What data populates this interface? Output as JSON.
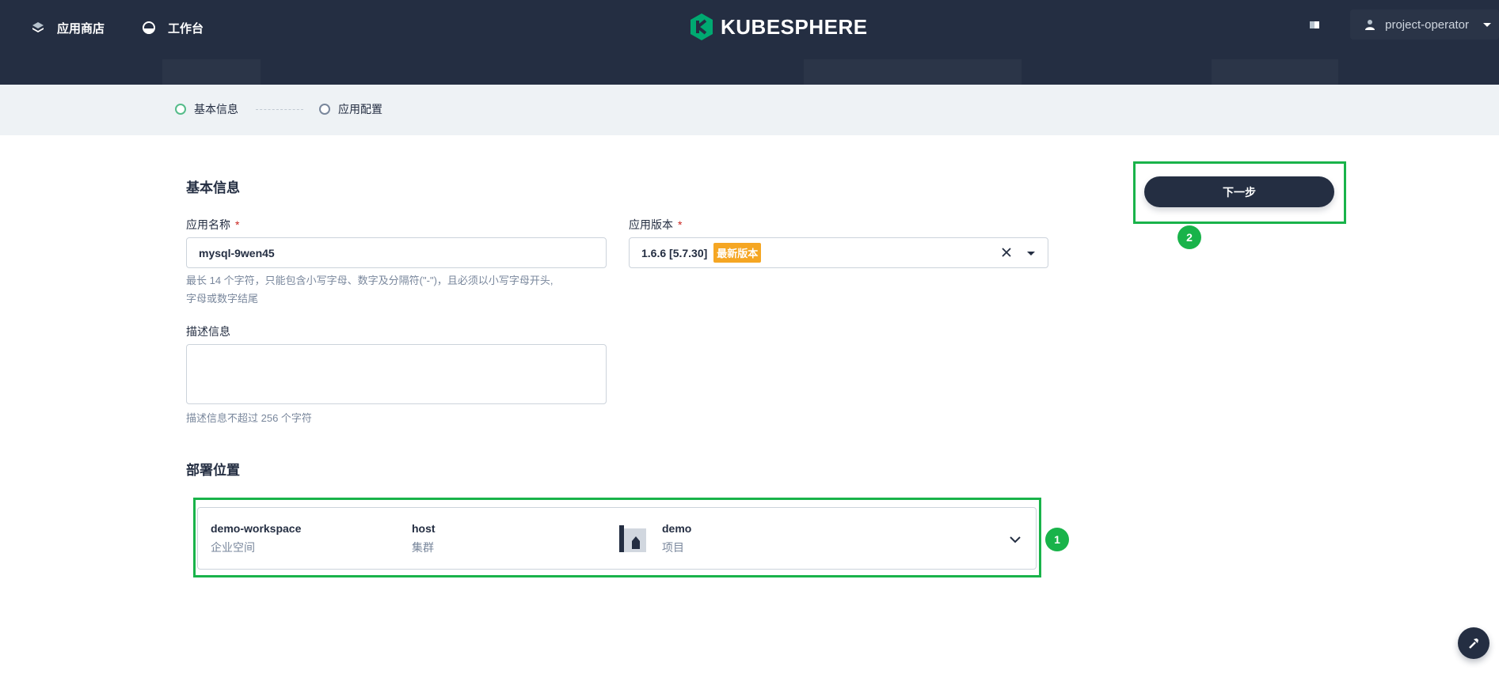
{
  "nav": {
    "app_store_label": "应用商店",
    "workbench_label": "工作台",
    "logo_text": "KUBESPHERE",
    "user_name": "project-operator"
  },
  "steps": [
    {
      "label": "基本信息",
      "active": true
    },
    {
      "label": "应用配置",
      "active": false
    }
  ],
  "basic_info": {
    "section_title": "基本信息",
    "name_label": "应用名称",
    "required_mark": "*",
    "name_value": "mysql-9wen45",
    "name_hint_line1": "最长 14 个字符，只能包含小写字母、数字及分隔符(\"-\")，且必须以小写字母开头,",
    "name_hint_line2": "字母或数字结尾",
    "version_label": "应用版本",
    "version_value": "1.6.6 [5.7.30]",
    "version_badge": "最新版本",
    "desc_label": "描述信息",
    "desc_value": "",
    "desc_hint": "描述信息不超过 256 个字符"
  },
  "deploy": {
    "section_title": "部署位置",
    "workspace_value": "demo-workspace",
    "workspace_label": "企业空间",
    "cluster_value": "host",
    "cluster_label": "集群",
    "project_value": "demo",
    "project_label": "项目"
  },
  "annotations": {
    "badge_1": "1",
    "badge_2": "2"
  },
  "actions": {
    "next_label": "下一步"
  },
  "colors": {
    "topbar_bg": "#242e42",
    "accent_green": "#55bc8a",
    "highlight_green": "#19b34a",
    "badge_orange": "#f5a623"
  }
}
